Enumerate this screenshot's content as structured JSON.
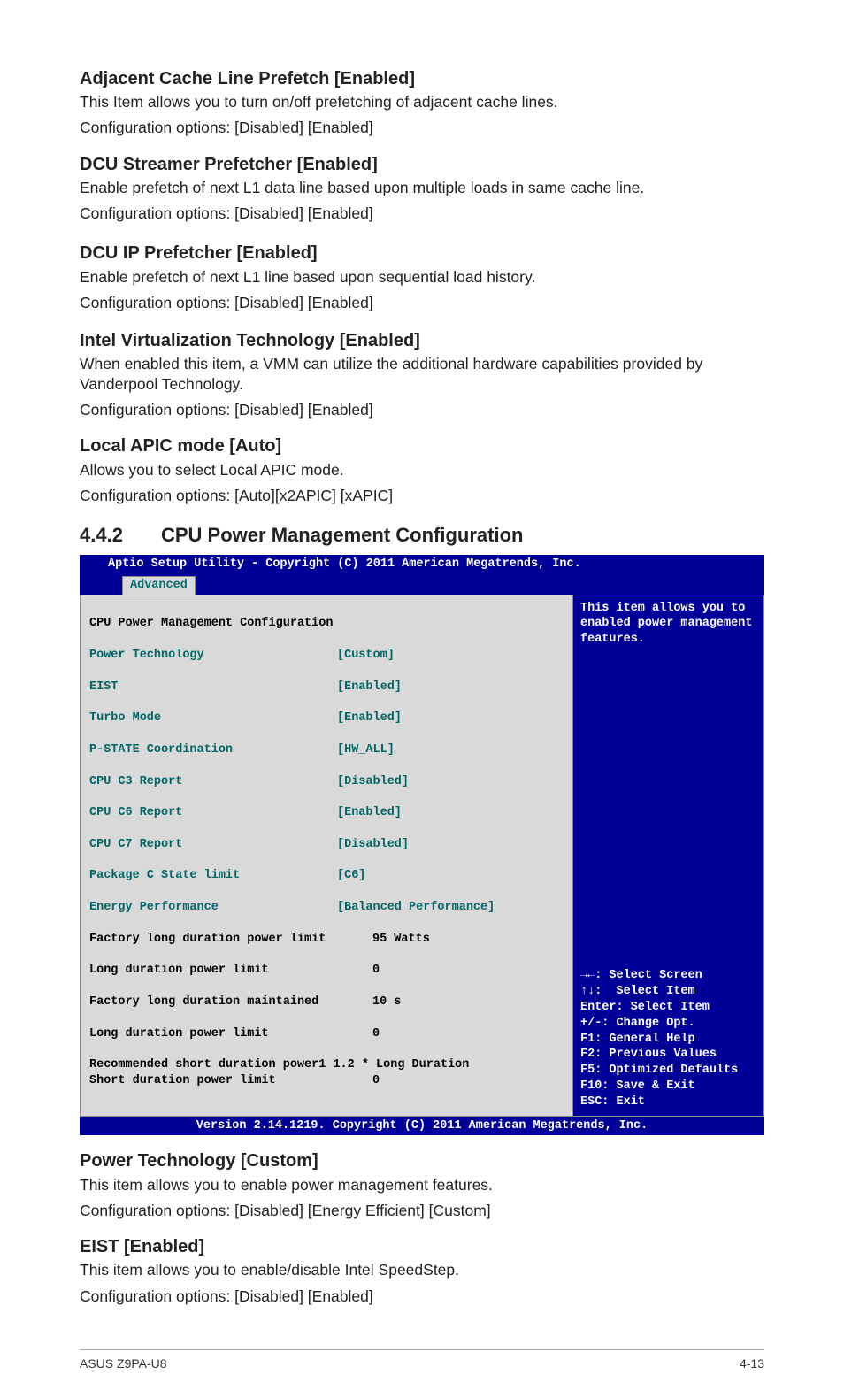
{
  "sections": {
    "adjacent": {
      "title": "Adjacent Cache Line Prefetch [Enabled]",
      "line1": "This Item allows you to turn on/off prefetching of adjacent cache lines.",
      "line2": "Configuration options: [Disabled] [Enabled]"
    },
    "dcu_streamer": {
      "title": "DCU Streamer Prefetcher [Enabled]",
      "line1": "Enable prefetch of next L1 data line based upon multiple loads in same cache line.",
      "line2": "Configuration options: [Disabled] [Enabled]"
    },
    "dcu_ip": {
      "title": "DCU IP Prefetcher [Enabled]",
      "line1": "Enable prefetch of next L1 line based upon sequential load history.",
      "line2": "Configuration options: [Disabled] [Enabled]"
    },
    "intel_vt": {
      "title": "Intel Virtualization Technology [Enabled]",
      "line1": "When enabled this item, a VMM can utilize the additional hardware capabilities provided by Vanderpool Technology.",
      "line2": "Configuration options: [Disabled] [Enabled]"
    },
    "local_apic": {
      "title": "Local APIC mode [Auto]",
      "line1": "Allows you to select Local APIC mode.",
      "line2": "Configuration options: [Auto][x2APIC] [xAPIC]"
    },
    "numbered": {
      "num": "4.4.2",
      "title": "CPU Power Management Configuration"
    },
    "power_tech": {
      "title": "Power Technology [Custom]",
      "line1": "This item allows you to enable power management features.",
      "line2": "Configuration options: [Disabled] [Energy Efficient] [Custom]"
    },
    "eist": {
      "title": "EIST [Enabled]",
      "line1": "This item allows you to enable/disable Intel SpeedStep.",
      "line2": "Configuration options: [Disabled] [Enabled]"
    }
  },
  "bios": {
    "header": "Aptio Setup Utility - Copyright (C) 2011 American Megatrends, Inc.",
    "tab": "Advanced",
    "left_title": "CPU Power Management Configuration",
    "rows": [
      {
        "label": "Power Technology",
        "value": "[Custom]"
      },
      {
        "label": "EIST",
        "value": "[Enabled]"
      },
      {
        "label": "Turbo Mode",
        "value": "[Enabled]"
      },
      {
        "label": "P-STATE Coordination",
        "value": "[HW_ALL]"
      },
      {
        "label": "CPU C3 Report",
        "value": "[Disabled]"
      },
      {
        "label": "CPU C6 Report",
        "value": "[Enabled]"
      },
      {
        "label": "CPU C7 Report",
        "value": "[Disabled]"
      },
      {
        "label": "Package C State limit",
        "value": "[C6]"
      },
      {
        "label": "Energy Performance",
        "value": "[Balanced Performance]"
      }
    ],
    "black_rows": [
      {
        "label": "Factory long duration power limit",
        "value": "95 Watts"
      },
      {
        "label": "Long duration power limit",
        "value": "0"
      },
      {
        "label": "Factory long duration maintained",
        "value": "10 s"
      },
      {
        "label": "Long duration power limit",
        "value": "0"
      },
      {
        "label": "Recommended short duration power1 1.2 * Long Duration",
        "value": ""
      },
      {
        "label": "Short duration power limit",
        "value": "0"
      }
    ],
    "help_top": "This item allows you to enabled power management features.",
    "help_bottom": "→←: Select Screen\n↑↓:  Select Item\nEnter: Select Item\n+/-: Change Opt.\nF1: General Help\nF2: Previous Values\nF5: Optimized Defaults\nF10: Save & Exit\nESC: Exit",
    "footer": "Version 2.14.1219. Copyright (C) 2011 American Megatrends, Inc."
  },
  "footer": {
    "left": "ASUS Z9PA-U8",
    "right": "4-13"
  }
}
